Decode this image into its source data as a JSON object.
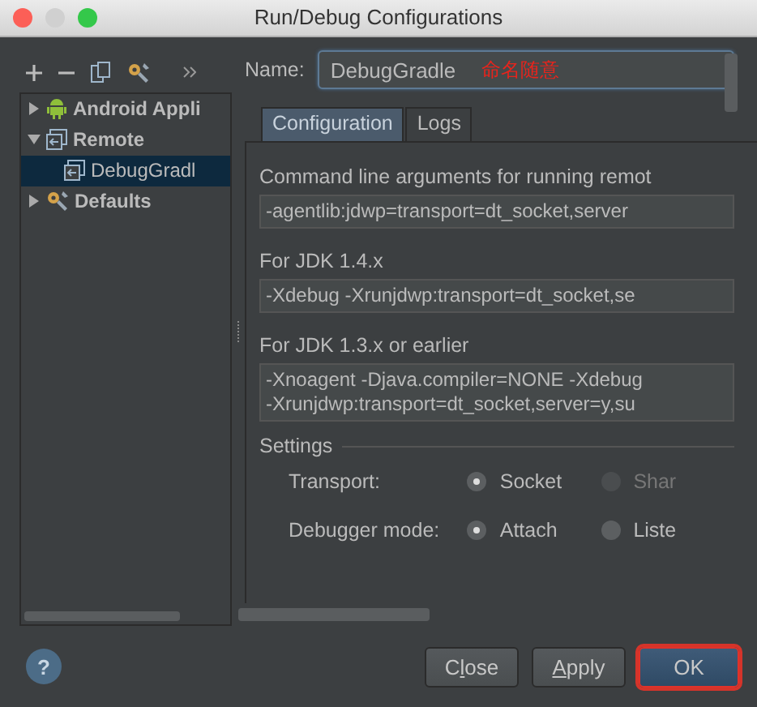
{
  "window": {
    "title": "Run/Debug Configurations"
  },
  "tree": [
    {
      "label": "Android Appli",
      "kind": "android",
      "expanded": false,
      "selected": false
    },
    {
      "label": "Remote",
      "kind": "remote",
      "expanded": true,
      "selected": false,
      "children": [
        {
          "label": "DebugGradl",
          "kind": "remote",
          "selected": true
        }
      ]
    },
    {
      "label": "Defaults",
      "kind": "defaults",
      "expanded": false,
      "selected": false
    }
  ],
  "name_field": {
    "label": "Name:",
    "value": "DebugGradle",
    "annotation": "命名随意"
  },
  "tabs": [
    {
      "label": "Configuration",
      "selected": true
    },
    {
      "label": "Logs",
      "selected": false
    }
  ],
  "sections": [
    {
      "label": "Command line arguments for running remot",
      "lines": [
        "-agentlib:jdwp=transport=dt_socket,server"
      ]
    },
    {
      "label": "For JDK 1.4.x",
      "lines": [
        "-Xdebug -Xrunjdwp:transport=dt_socket,se"
      ]
    },
    {
      "label": "For JDK 1.3.x or earlier",
      "lines": [
        "-Xnoagent -Djava.compiler=NONE -Xdebug",
        "-Xrunjdwp:transport=dt_socket,server=y,su"
      ]
    }
  ],
  "settings": {
    "title": "Settings",
    "rows": [
      {
        "label": "Transport:",
        "options": [
          {
            "label": "Socket",
            "selected": true,
            "disabled": false
          },
          {
            "label": "Shar",
            "selected": false,
            "disabled": true
          }
        ]
      },
      {
        "label": "Debugger mode:",
        "options": [
          {
            "label": "Attach",
            "selected": true,
            "disabled": false
          },
          {
            "label": "Liste",
            "selected": false,
            "disabled": false
          }
        ]
      }
    ]
  },
  "help": {
    "label": "?"
  },
  "buttons": [
    {
      "parts": [
        {
          "text": "C",
          "underline": false
        },
        {
          "text": "l",
          "underline": true
        },
        {
          "text": "ose",
          "underline": false
        }
      ],
      "default": false
    },
    {
      "parts": [
        {
          "text": "A",
          "underline": true
        },
        {
          "text": "pply",
          "underline": false
        }
      ],
      "default": false
    },
    {
      "parts": [
        {
          "text": "OK",
          "underline": false
        }
      ],
      "default": true
    }
  ]
}
